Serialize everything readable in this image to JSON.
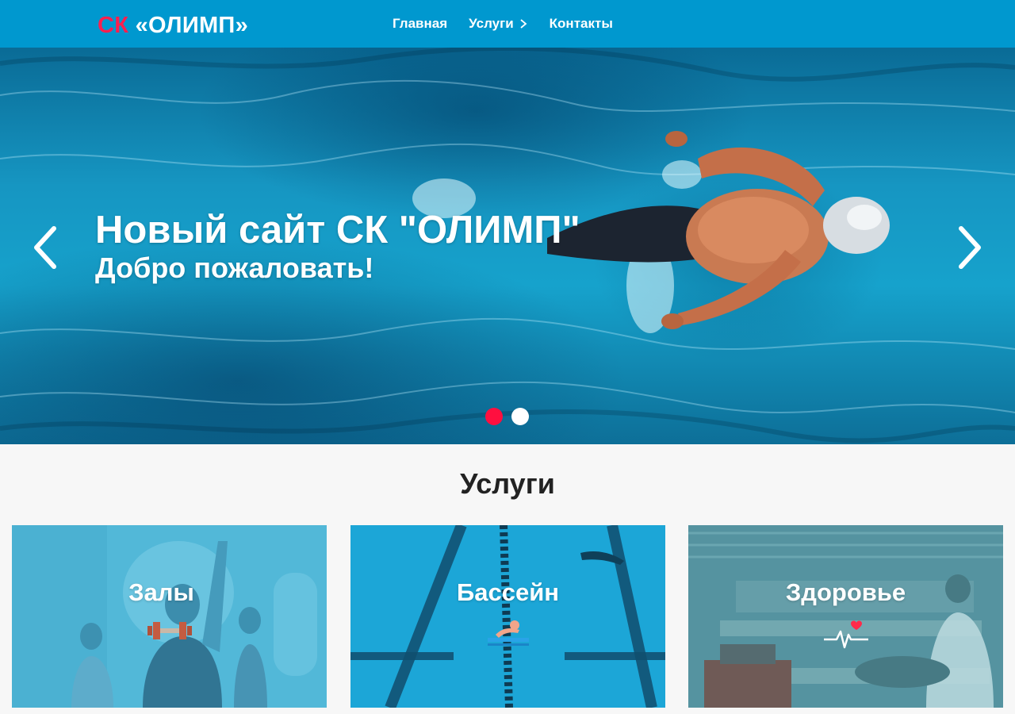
{
  "header": {
    "logo_prefix": "СК",
    "logo_name": "«ОЛИМП»",
    "nav": [
      {
        "label": "Главная"
      },
      {
        "label": "Услуги"
      },
      {
        "label": "Контакты"
      }
    ],
    "brand_color": "#0098cf",
    "accent_color": "#ff1f4e"
  },
  "hero": {
    "title": "Новый сайт СК \"ОЛИМП\"",
    "subtitle": "Добро пожаловать!",
    "slide_count": 2,
    "active_slide": 1
  },
  "services": {
    "heading": "Услуги",
    "items": [
      {
        "title": "Залы",
        "icon": "dumbbell-icon"
      },
      {
        "title": "Бассейн",
        "icon": "swimmer-icon"
      },
      {
        "title": "Здоровье",
        "icon": "heartbeat-icon"
      }
    ]
  }
}
